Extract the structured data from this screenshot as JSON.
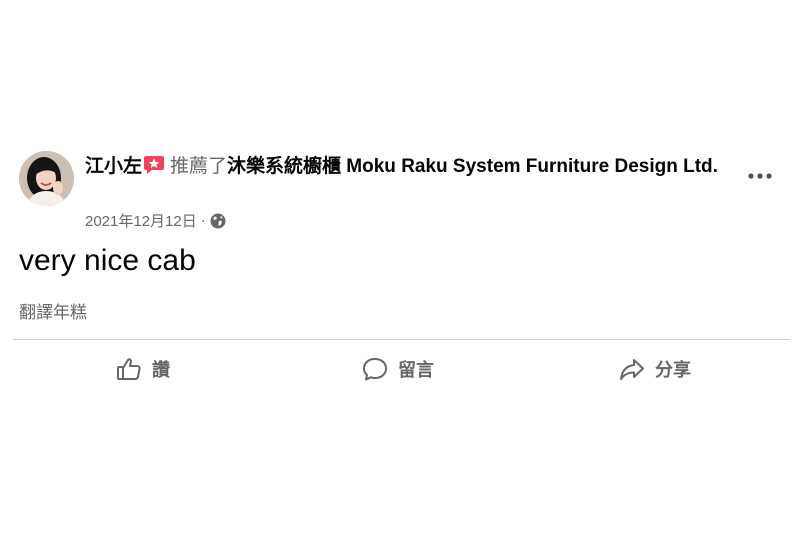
{
  "post": {
    "author": "江小左",
    "verb": "推薦了",
    "page_name": "沐樂系統櫥櫃 Moku Raku System Furniture Design Ltd.",
    "date": "2021年12月12日",
    "separator": "·",
    "body": "very nice cab",
    "translate_label": "翻譯年糕"
  },
  "actions": {
    "like_label": "讚",
    "comment_label": "留言",
    "share_label": "分享"
  },
  "icons": {
    "badge": "star-badge-icon",
    "audience": "globe-icon",
    "more": "more-dots-icon",
    "like": "thumbs-up-icon",
    "comment": "comment-bubble-icon",
    "share": "share-arrow-icon"
  },
  "colors": {
    "text_primary": "#050505",
    "text_secondary": "#65676b",
    "divider": "#ced0d4",
    "badge": "#f3425f"
  }
}
